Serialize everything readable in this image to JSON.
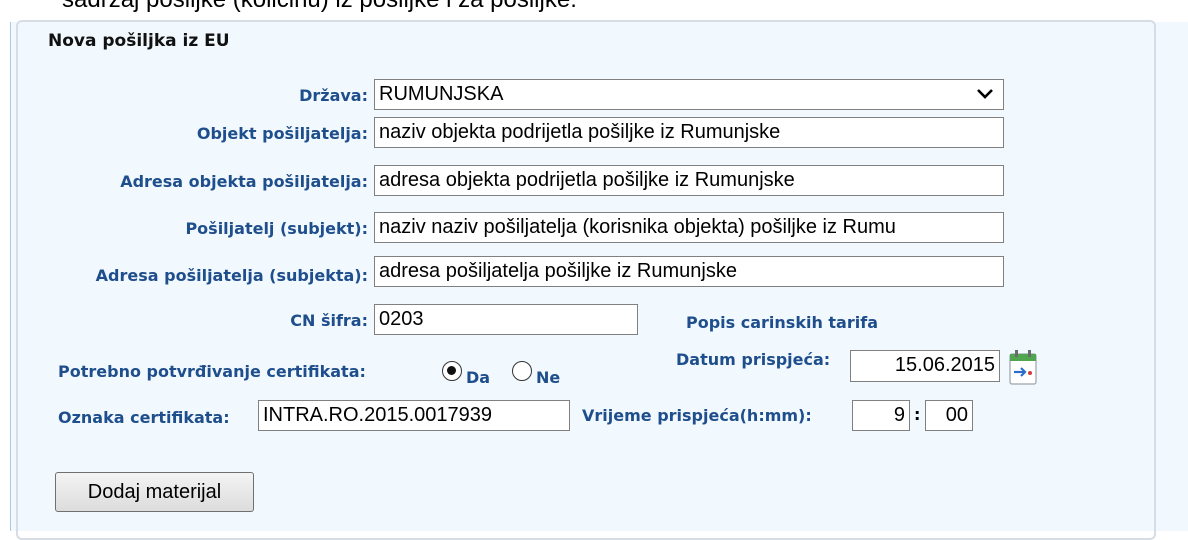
{
  "top_cut_text": "sadržaj pošiljke (količinu) iz pošiljke i za pošiljke:",
  "section": {
    "legend": "Nova pošiljka iz EU"
  },
  "fields": {
    "drzava": {
      "label": "Država:",
      "value": "RUMUNJSKA"
    },
    "objekt": {
      "label": "Objekt pošiljatelja:",
      "value": "naziv objekta podrijetla pošiljke iz Rumunjske"
    },
    "adresa_objekta": {
      "label": "Adresa objekta pošiljatelja:",
      "value": "adresa objekta podrijetla pošiljke iz Rumunjske"
    },
    "posiljatelj": {
      "label": "Pošiljatelj (subjekt):",
      "value": "naziv naziv pošiljatelja (korisnika objekta) pošiljke iz Rumu"
    },
    "adresa_posiljatelja": {
      "label": "Adresa pošiljatelja (subjekta):",
      "value": "adresa pošiljatelja pošiljke iz Rumunjske"
    },
    "cn": {
      "label": "CN šifra:",
      "value": "0203",
      "link": "Popis carinskih tarifa"
    },
    "certifikat": {
      "label": "Potrebno potvrđivanje certifikata:",
      "yes": "Da",
      "no": "Ne",
      "selected": "Da"
    },
    "datum": {
      "label": "Datum prispjeća:",
      "value": "15.06.2015"
    },
    "oznaka": {
      "label": "Oznaka certifikata:",
      "value": "INTRA.RO.2015.0017939"
    },
    "vrijeme": {
      "label": "Vrijeme prispjeća(h:mm):",
      "hours": "9",
      "sep": ":",
      "minutes": "00"
    }
  },
  "button": {
    "label": "Dodaj materijal"
  },
  "icons": {
    "dropdown": "chevron-down-icon",
    "calendar": "calendar-icon"
  },
  "colors": {
    "label": "#1f4e8c",
    "panel": "#f1f8fe"
  }
}
